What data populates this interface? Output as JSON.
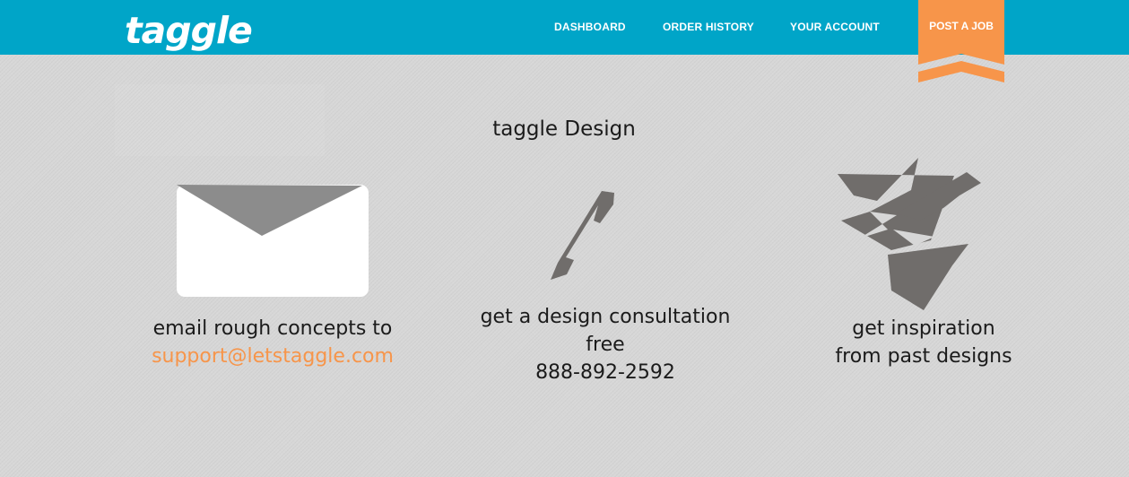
{
  "header": {
    "logo_text": "taggle",
    "nav": {
      "dashboard": "DASHBOARD",
      "order_history": "ORDER HISTORY",
      "your_account": "YOUR ACCOUNT"
    },
    "post_job_label": "POST A JOB"
  },
  "main": {
    "title": "taggle Design",
    "features": {
      "email": {
        "icon": "envelope-icon",
        "line1": "email rough concepts to",
        "link": "support@letstaggle.com"
      },
      "phone": {
        "icon": "phone-icon",
        "line1": "get a design consultation",
        "line2": "free",
        "phone_number": "888-892-2592"
      },
      "inspiration": {
        "icon": "paper-plane-icon",
        "line1": "get inspiration",
        "line2": "from past designs"
      }
    }
  },
  "colors": {
    "header_bg": "#00a5c8",
    "page_bg": "#d7d7d7",
    "accent_orange": "#f7954a",
    "icon_gray": "#706d6b",
    "text_dark": "#1b1b1b"
  }
}
